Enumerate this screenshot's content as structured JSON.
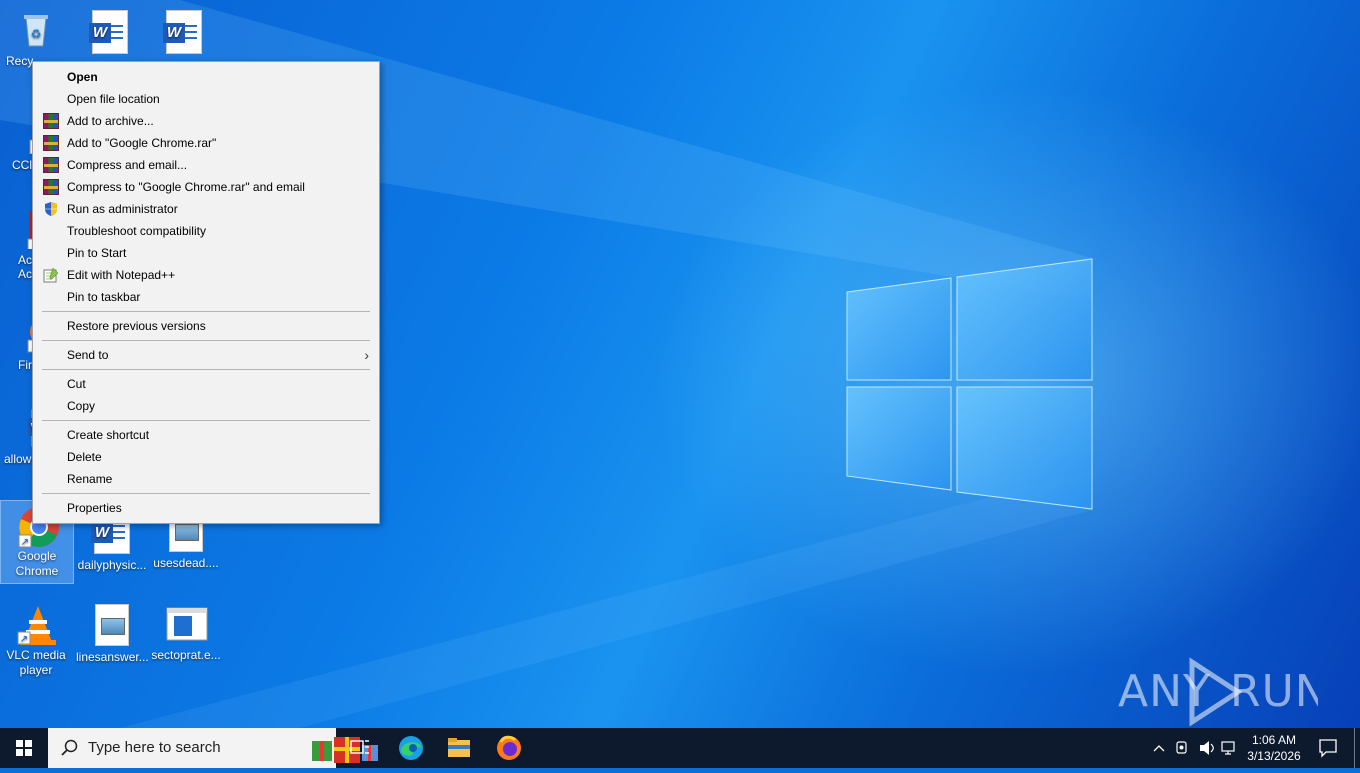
{
  "desktop": {
    "icons": [
      {
        "label": "Recy"
      },
      {
        "label": "CCl"
      },
      {
        "label": "Ac\nAc"
      },
      {
        "label": "Fir"
      },
      {
        "label": "allow"
      },
      {
        "label": "Google Chrome"
      },
      {
        "label": "dailyphysic..."
      },
      {
        "label": "usesdead...."
      },
      {
        "label": "VLC media player"
      },
      {
        "label": "linesanswer..."
      },
      {
        "label": "sectoprat.e..."
      }
    ],
    "watermark": "ANY RUN"
  },
  "context_menu": {
    "items": [
      {
        "label": "Open",
        "icon": ""
      },
      {
        "label": "Open file location",
        "icon": ""
      },
      {
        "label": "Add to archive...",
        "icon": "winrar-icon"
      },
      {
        "label": "Add to \"Google Chrome.rar\"",
        "icon": "winrar-icon"
      },
      {
        "label": "Compress and email...",
        "icon": "winrar-icon"
      },
      {
        "label": "Compress to \"Google Chrome.rar\" and email",
        "icon": "winrar-icon"
      },
      {
        "label": "Run as administrator",
        "icon": "uac-shield-icon"
      },
      {
        "label": "Troubleshoot compatibility",
        "icon": ""
      },
      {
        "label": "Pin to Start",
        "icon": ""
      },
      {
        "label": "Edit with Notepad++",
        "icon": "notepadpp-icon"
      },
      {
        "label": "Pin to taskbar",
        "icon": ""
      },
      {
        "label": "Restore previous versions",
        "icon": ""
      },
      {
        "label": "Send to",
        "icon": ""
      },
      {
        "label": "Cut",
        "icon": ""
      },
      {
        "label": "Copy",
        "icon": ""
      },
      {
        "label": "Create shortcut",
        "icon": ""
      },
      {
        "label": "Delete",
        "icon": ""
      },
      {
        "label": "Rename",
        "icon": ""
      },
      {
        "label": "Properties",
        "icon": ""
      }
    ]
  },
  "taskbar": {
    "search_placeholder": "Type here to search",
    "clock_time": "1:06 AM",
    "clock_date": "3/13/2026"
  },
  "colors": {
    "taskbar": "#0d1a2e",
    "menu_bg": "#f2f2f2",
    "wallpaper": "#0b7be6"
  }
}
